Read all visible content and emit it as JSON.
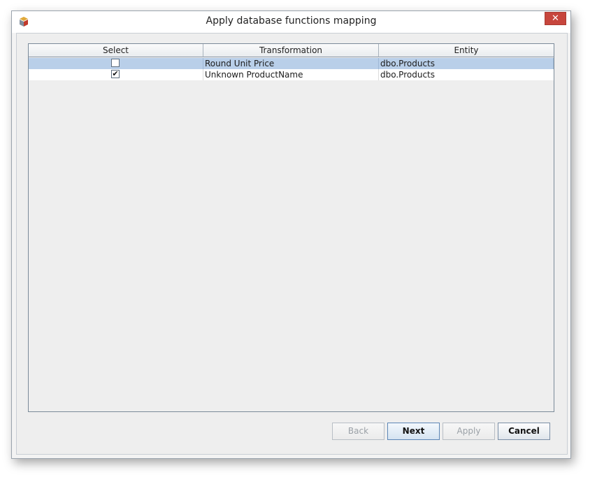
{
  "window": {
    "title": "Apply database functions mapping",
    "close_label": "✕",
    "app_icon": "app-icon"
  },
  "table": {
    "columns": [
      "Select",
      "Transformation",
      "Entity"
    ],
    "rows": [
      {
        "selected_row": true,
        "checked": false,
        "check_mark": "",
        "transformation": "Round Unit Price",
        "entity": "dbo.Products"
      },
      {
        "selected_row": false,
        "checked": true,
        "check_mark": "✔",
        "transformation": "Unknown ProductName",
        "entity": "dbo.Products"
      }
    ]
  },
  "buttons": {
    "back": {
      "label": "Back",
      "enabled": false
    },
    "next": {
      "label": "Next",
      "enabled": true
    },
    "apply": {
      "label": "Apply",
      "enabled": false
    },
    "cancel": {
      "label": "Cancel",
      "enabled": true
    }
  },
  "colors": {
    "selected_row": "#b9cfe9",
    "close_button": "#c7463d"
  }
}
